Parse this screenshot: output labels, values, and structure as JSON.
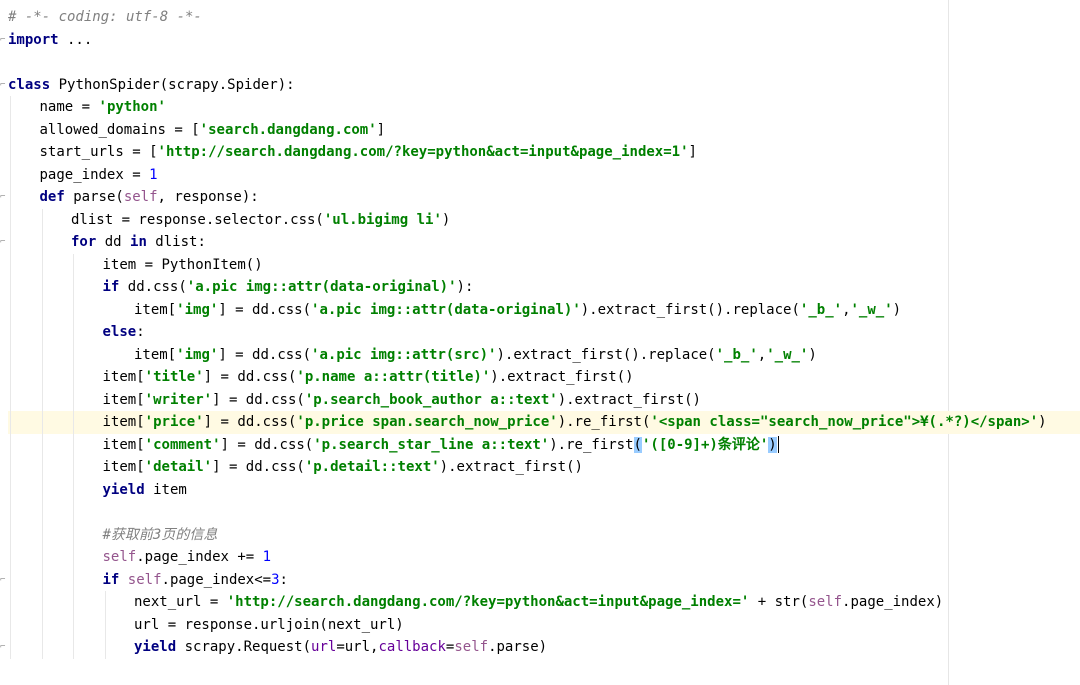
{
  "editor": {
    "language": "python",
    "current_line_index": 18,
    "colors": {
      "keyword": "#000080",
      "string": "#008000",
      "number": "#0000ff",
      "comment": "#808080",
      "self": "#94558d",
      "kwarg": "#660099",
      "current_line_bg": "#fffae3"
    },
    "lines": [
      {
        "indent": 0,
        "fold": false,
        "tokens": [
          {
            "t": "cmt",
            "v": "# -*- coding: utf-8 -*-"
          }
        ]
      },
      {
        "indent": 0,
        "fold": true,
        "tokens": [
          {
            "t": "kw",
            "v": "import"
          },
          {
            "t": "plain",
            "v": " ..."
          }
        ]
      },
      {
        "indent": 0,
        "fold": false,
        "tokens": []
      },
      {
        "indent": 0,
        "fold": true,
        "tokens": [
          {
            "t": "kw",
            "v": "class"
          },
          {
            "t": "plain",
            "v": " PythonSpider(scrapy.Spider):"
          }
        ]
      },
      {
        "indent": 1,
        "fold": false,
        "tokens": [
          {
            "t": "plain",
            "v": "name = "
          },
          {
            "t": "str",
            "v": "'python'"
          }
        ]
      },
      {
        "indent": 1,
        "fold": false,
        "tokens": [
          {
            "t": "plain",
            "v": "allowed_domains = ["
          },
          {
            "t": "str",
            "v": "'search.dangdang.com'"
          },
          {
            "t": "plain",
            "v": "]"
          }
        ]
      },
      {
        "indent": 1,
        "fold": false,
        "tokens": [
          {
            "t": "plain",
            "v": "start_urls = ["
          },
          {
            "t": "str",
            "v": "'http://search.dangdang.com/?key=python&act=input&page_index=1'"
          },
          {
            "t": "plain",
            "v": "]"
          }
        ]
      },
      {
        "indent": 1,
        "fold": false,
        "tokens": [
          {
            "t": "plain",
            "v": "page_index = "
          },
          {
            "t": "num",
            "v": "1"
          }
        ]
      },
      {
        "indent": 1,
        "fold": true,
        "tokens": [
          {
            "t": "kw",
            "v": "def"
          },
          {
            "t": "plain",
            "v": " parse("
          },
          {
            "t": "self",
            "v": "self"
          },
          {
            "t": "plain",
            "v": ", response):"
          }
        ]
      },
      {
        "indent": 2,
        "fold": false,
        "tokens": [
          {
            "t": "plain",
            "v": "dlist = response.selector.css("
          },
          {
            "t": "str",
            "v": "'ul.bigimg li'"
          },
          {
            "t": "plain",
            "v": ")"
          }
        ]
      },
      {
        "indent": 2,
        "fold": true,
        "tokens": [
          {
            "t": "kw",
            "v": "for"
          },
          {
            "t": "plain",
            "v": " dd "
          },
          {
            "t": "kw",
            "v": "in"
          },
          {
            "t": "plain",
            "v": " dlist:"
          }
        ]
      },
      {
        "indent": 3,
        "fold": false,
        "tokens": [
          {
            "t": "plain",
            "v": "item = PythonItem()"
          }
        ]
      },
      {
        "indent": 3,
        "fold": false,
        "tokens": [
          {
            "t": "kw",
            "v": "if"
          },
          {
            "t": "plain",
            "v": " dd.css("
          },
          {
            "t": "str",
            "v": "'a.pic img::attr(data-original)'"
          },
          {
            "t": "plain",
            "v": "):"
          }
        ]
      },
      {
        "indent": 4,
        "fold": false,
        "tokens": [
          {
            "t": "plain",
            "v": "item["
          },
          {
            "t": "str",
            "v": "'img'"
          },
          {
            "t": "plain",
            "v": "] = dd.css("
          },
          {
            "t": "str",
            "v": "'a.pic img::attr(data-original)'"
          },
          {
            "t": "plain",
            "v": ").extract_first().replace("
          },
          {
            "t": "str",
            "v": "'_b_'"
          },
          {
            "t": "plain",
            "v": ","
          },
          {
            "t": "str",
            "v": "'_w_'"
          },
          {
            "t": "plain",
            "v": ")"
          }
        ]
      },
      {
        "indent": 3,
        "fold": false,
        "tokens": [
          {
            "t": "kw",
            "v": "else"
          },
          {
            "t": "plain",
            "v": ":"
          }
        ]
      },
      {
        "indent": 4,
        "fold": false,
        "tokens": [
          {
            "t": "plain",
            "v": "item["
          },
          {
            "t": "str",
            "v": "'img'"
          },
          {
            "t": "plain",
            "v": "] = dd.css("
          },
          {
            "t": "str",
            "v": "'a.pic img::attr(src)'"
          },
          {
            "t": "plain",
            "v": ").extract_first().replace("
          },
          {
            "t": "str",
            "v": "'_b_'"
          },
          {
            "t": "plain",
            "v": ","
          },
          {
            "t": "str",
            "v": "'_w_'"
          },
          {
            "t": "plain",
            "v": ")"
          }
        ]
      },
      {
        "indent": 3,
        "fold": false,
        "tokens": [
          {
            "t": "plain",
            "v": "item["
          },
          {
            "t": "str",
            "v": "'title'"
          },
          {
            "t": "plain",
            "v": "] = dd.css("
          },
          {
            "t": "str",
            "v": "'p.name a::attr(title)'"
          },
          {
            "t": "plain",
            "v": ").extract_first()"
          }
        ]
      },
      {
        "indent": 3,
        "fold": false,
        "tokens": [
          {
            "t": "plain",
            "v": "item["
          },
          {
            "t": "str",
            "v": "'writer'"
          },
          {
            "t": "plain",
            "v": "] = dd.css("
          },
          {
            "t": "str",
            "v": "'p.search_book_author a::text'"
          },
          {
            "t": "plain",
            "v": ").extract_first()"
          }
        ]
      },
      {
        "indent": 3,
        "fold": false,
        "tokens": [
          {
            "t": "plain",
            "v": "item["
          },
          {
            "t": "str",
            "v": "'price'"
          },
          {
            "t": "plain",
            "v": "] = dd.css("
          },
          {
            "t": "str",
            "v": "'p.price span.search_now_price'"
          },
          {
            "t": "plain",
            "v": ").re_first("
          },
          {
            "t": "str",
            "v": "'<span class=\"search_now_price\">¥(.*?)</span>'"
          },
          {
            "t": "plain",
            "v": ")"
          }
        ]
      },
      {
        "indent": 3,
        "fold": false,
        "tokens": [
          {
            "t": "plain",
            "v": "item["
          },
          {
            "t": "str",
            "v": "'comment'"
          },
          {
            "t": "plain",
            "v": "] = dd.css("
          },
          {
            "t": "str",
            "v": "'p.search_star_line a::text'"
          },
          {
            "t": "plain",
            "v": ").re_first"
          },
          {
            "t": "bracket",
            "v": "("
          },
          {
            "t": "str",
            "v": "'([0-9]+)条评论'"
          },
          {
            "t": "bracket",
            "v": ")"
          },
          {
            "t": "caret",
            "v": ""
          }
        ]
      },
      {
        "indent": 3,
        "fold": false,
        "tokens": [
          {
            "t": "plain",
            "v": "item["
          },
          {
            "t": "str",
            "v": "'detail'"
          },
          {
            "t": "plain",
            "v": "] = dd.css("
          },
          {
            "t": "str",
            "v": "'p.detail::text'"
          },
          {
            "t": "plain",
            "v": ").extract_first()"
          }
        ]
      },
      {
        "indent": 3,
        "fold": false,
        "tokens": [
          {
            "t": "kw",
            "v": "yield"
          },
          {
            "t": "plain",
            "v": " item"
          }
        ]
      },
      {
        "indent": 0,
        "fold": false,
        "tokens": []
      },
      {
        "indent": 3,
        "fold": false,
        "tokens": [
          {
            "t": "cmt",
            "v": "#获取前3页的信息"
          }
        ]
      },
      {
        "indent": 3,
        "fold": false,
        "tokens": [
          {
            "t": "self",
            "v": "self"
          },
          {
            "t": "plain",
            "v": ".page_index += "
          },
          {
            "t": "num",
            "v": "1"
          }
        ]
      },
      {
        "indent": 3,
        "fold": true,
        "tokens": [
          {
            "t": "kw",
            "v": "if"
          },
          {
            "t": "plain",
            "v": " "
          },
          {
            "t": "self",
            "v": "self"
          },
          {
            "t": "plain",
            "v": ".page_index<="
          },
          {
            "t": "num",
            "v": "3"
          },
          {
            "t": "plain",
            "v": ":"
          }
        ]
      },
      {
        "indent": 4,
        "fold": false,
        "tokens": [
          {
            "t": "plain",
            "v": "next_url = "
          },
          {
            "t": "str",
            "v": "'http://search.dangdang.com/?key=python&act=input&page_index='"
          },
          {
            "t": "plain",
            "v": " + str("
          },
          {
            "t": "self",
            "v": "self"
          },
          {
            "t": "plain",
            "v": ".page_index)"
          }
        ]
      },
      {
        "indent": 4,
        "fold": false,
        "tokens": [
          {
            "t": "plain",
            "v": "url = response.urljoin(next_url)"
          }
        ]
      },
      {
        "indent": 4,
        "fold": true,
        "tokens": [
          {
            "t": "kw",
            "v": "yield"
          },
          {
            "t": "plain",
            "v": " scrapy.Request("
          },
          {
            "t": "kwarg",
            "v": "url"
          },
          {
            "t": "plain",
            "v": "=url,"
          },
          {
            "t": "kwarg",
            "v": "callback"
          },
          {
            "t": "plain",
            "v": "="
          },
          {
            "t": "self",
            "v": "self"
          },
          {
            "t": "plain",
            "v": ".parse)"
          }
        ]
      }
    ]
  }
}
